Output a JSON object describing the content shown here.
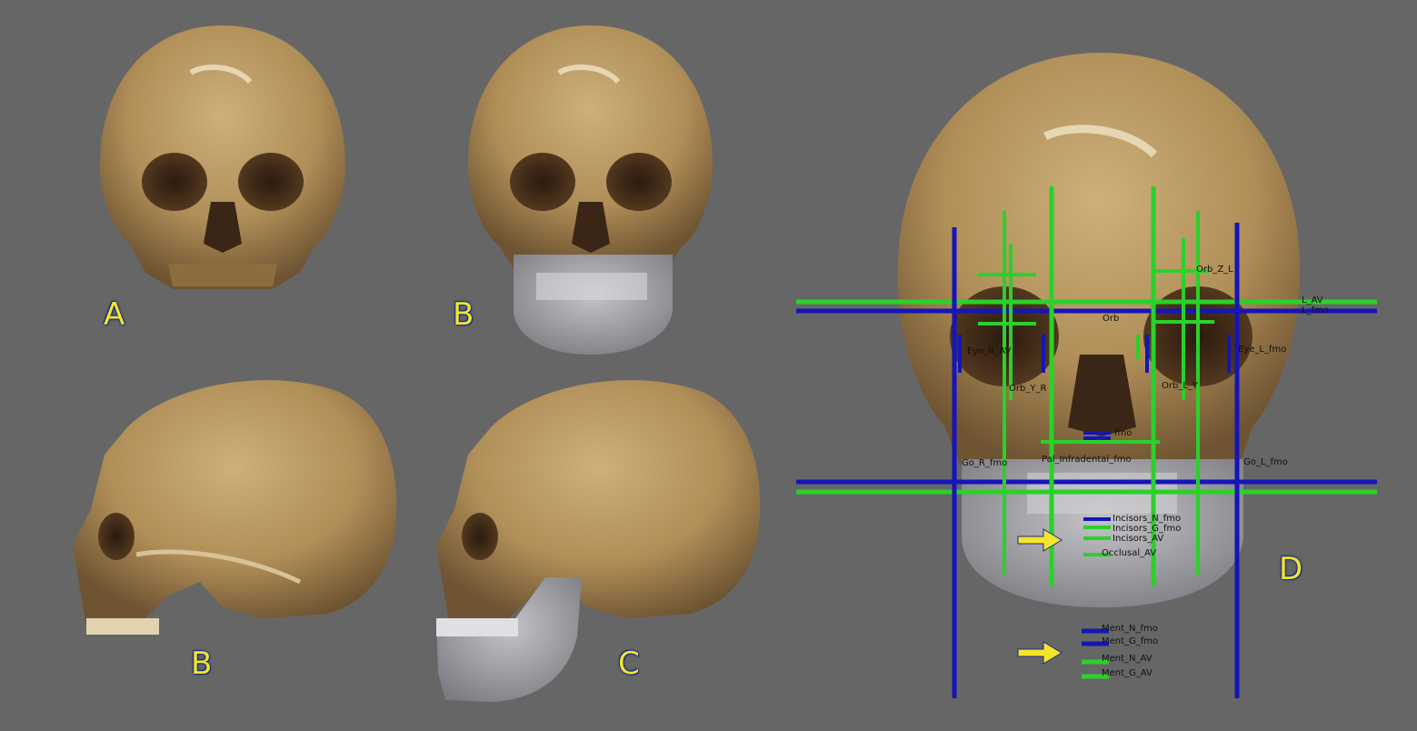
{
  "panels": {
    "a": {
      "letter": "A"
    },
    "b_front": {
      "letter": "B"
    },
    "b_side": {
      "letter": "B"
    },
    "c": {
      "letter": "C"
    },
    "d": {
      "letter": "D"
    }
  },
  "landmarks": {
    "orb_z_l": "Orb_Z_L",
    "orb": "Orb",
    "l_av": "L_AV",
    "l_fmo": "L_fmo",
    "eye_l_fmo": "Eye_L_fmo",
    "eye_r_av": "Eye_R_AV",
    "orb_y_r": "Orb_Y_R",
    "orb_l_y": "Orb_L_Y",
    "go_r_fmo": "Go_R_fmo",
    "go_l_fmo": "Go_L_fmo",
    "pal_infra": "Pal_Infradental_fmo",
    "fmo": "fmo",
    "incisors_n": "Incisors_N_fmo",
    "incisors_g": "Incisors_G_fmo",
    "incisors_av": "Incisors_AV",
    "occlusal_av": "Occlusal_AV",
    "ment_n_fmo": "Ment_N_fmo",
    "ment_g_fmo": "Ment_G_fmo",
    "ment_n_av": "Ment_N_AV",
    "ment_g_av": "Ment_G_AV"
  },
  "colors": {
    "background": "#666666",
    "bone": "#b89866",
    "mandible": "#a8a8ac",
    "line_blue": "#1515b8",
    "line_green": "#2ad12a",
    "arrow": "#f5e52a",
    "letter": "#f2e62a"
  }
}
